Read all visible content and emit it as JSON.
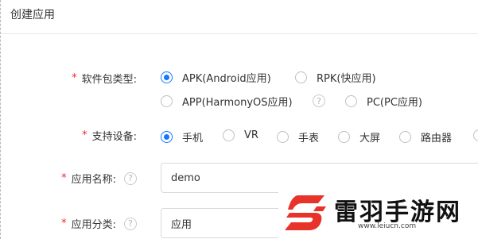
{
  "page": {
    "title": "创建应用"
  },
  "form": {
    "package_type": {
      "required_mark": "*",
      "label": "软件包类型:",
      "options": [
        {
          "label": "APK(Android应用)",
          "checked": true
        },
        {
          "label": "RPK(快应用)",
          "checked": false
        },
        {
          "label": "APP(HarmonyOS应用)",
          "checked": false
        },
        {
          "label": "PC(PC应用)",
          "checked": false
        }
      ],
      "help_icon": "?"
    },
    "devices": {
      "required_mark": "*",
      "label": "支持设备:",
      "options": [
        {
          "label": "手机",
          "checked": true
        },
        {
          "label": "VR",
          "checked": false
        },
        {
          "label": "手表",
          "checked": false
        },
        {
          "label": "大屏",
          "checked": false
        },
        {
          "label": "路由器",
          "checked": false
        }
      ]
    },
    "app_name": {
      "required_mark": "*",
      "label": "应用名称:",
      "help_icon": "?",
      "value": "demo"
    },
    "app_category": {
      "required_mark": "*",
      "label": "应用分类:",
      "help_icon": "?",
      "value": "应用"
    }
  },
  "watermark": {
    "text": "雷羽手游网",
    "url": "www.leiucn.com",
    "logo_color": "#e8332a",
    "icon": "watermark-logo-icon"
  },
  "colors": {
    "accent": "#1677ff",
    "required": "#f5222d"
  }
}
